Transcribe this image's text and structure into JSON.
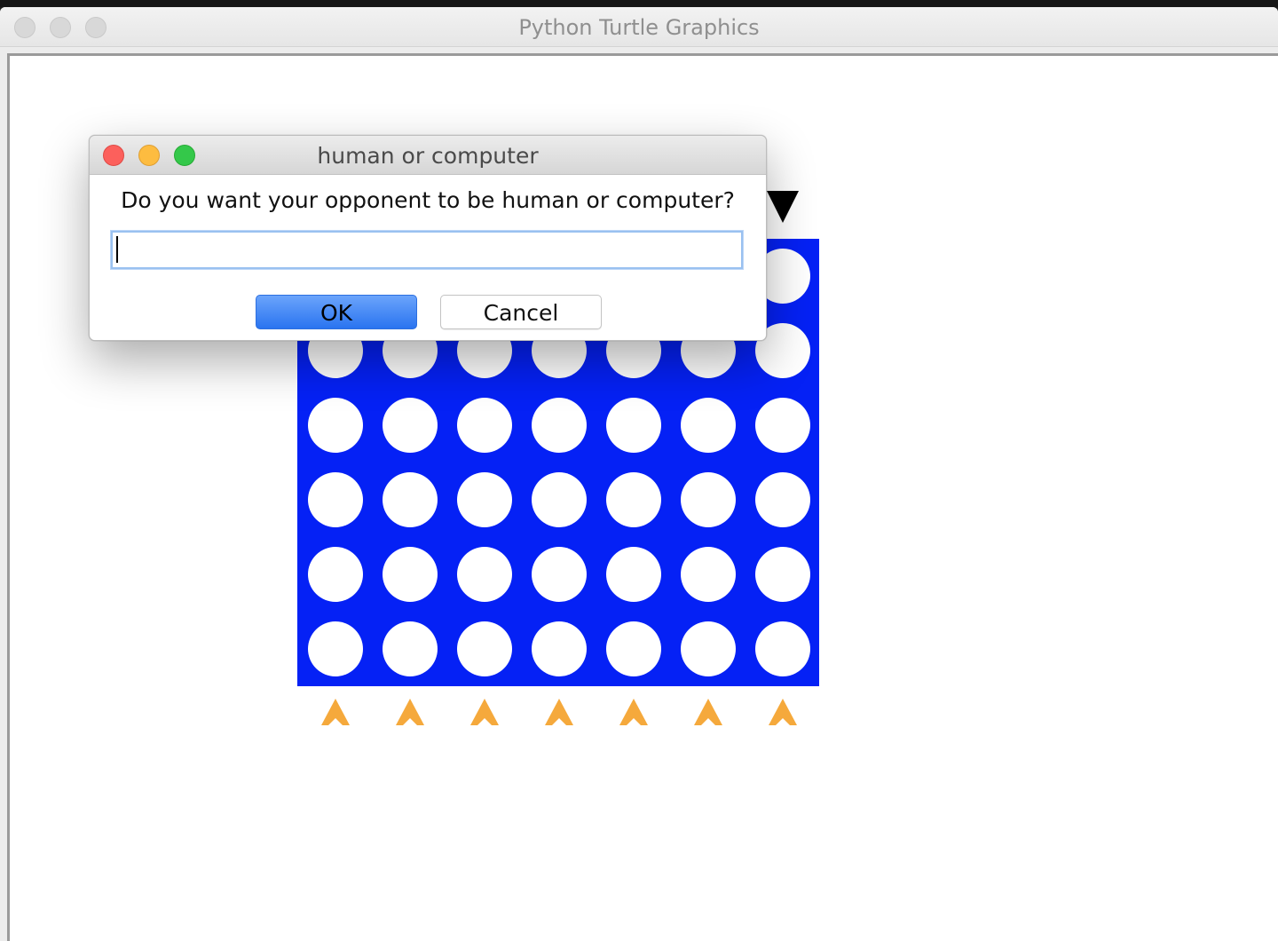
{
  "window": {
    "title": "Python Turtle Graphics"
  },
  "board": {
    "rows": 6,
    "columns": 7,
    "board_color": "#0521f5",
    "empty_slot_color": "#ffffff",
    "column_arrow_color": "#f5a93c",
    "drop_marker_color": "#000000",
    "column_arrow_icon": "arrow-up-icon",
    "drop_marker_icon": "triangle-down-icon"
  },
  "dialog": {
    "title": "human or computer",
    "prompt": "Do you want your opponent to be human or computer?",
    "input_value": "",
    "ok_label": "OK",
    "cancel_label": "Cancel"
  }
}
